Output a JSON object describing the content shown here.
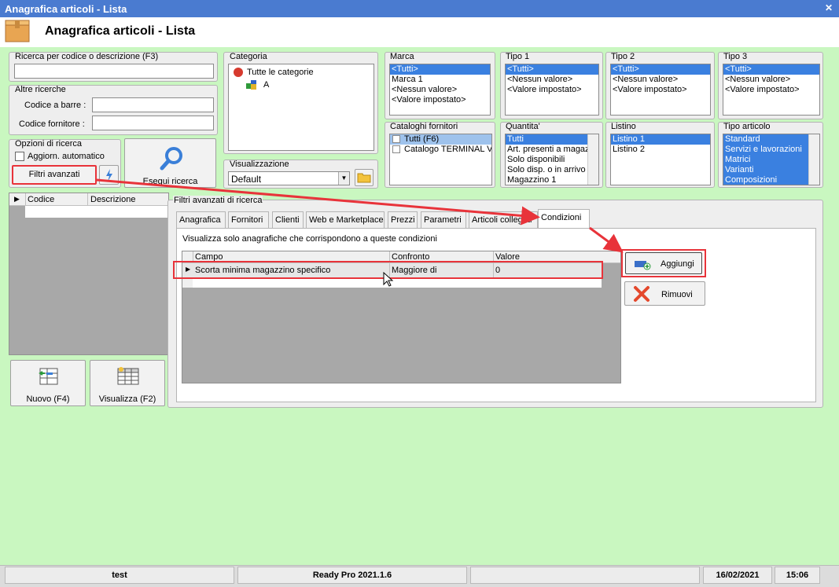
{
  "window": {
    "title": "Anagrafica articoli  - Lista",
    "header_title": "Anagrafica articoli  - Lista"
  },
  "search": {
    "code_desc_label": "Ricerca per codice o descrizione (F3)",
    "other_label": "Altre ricerche",
    "barcode_label": "Codice a barre :",
    "supplier_code_label": "Codice fornitore :",
    "options_label": "Opzioni di ricerca",
    "auto_update_label": "Aggiorn. automatico",
    "advanced_filters_button": "Filtri avanzati",
    "execute_button": "Esegui ricerca"
  },
  "categoria": {
    "label": "Categoria",
    "items": [
      "Tutte le categorie",
      "A"
    ]
  },
  "visualizzazione": {
    "label": "Visualizzazione",
    "value": "Default"
  },
  "marca": {
    "label": "Marca",
    "items": [
      "<Tutti>",
      "Marca 1",
      "<Nessun valore>",
      "<Valore impostato>"
    ]
  },
  "tipo1": {
    "label": "Tipo 1",
    "items": [
      "<Tutti>",
      "<Nessun valore>",
      "<Valore impostato>"
    ]
  },
  "tipo2": {
    "label": "Tipo 2",
    "items": [
      "<Tutti>",
      "<Nessun valore>",
      "<Valore impostato>"
    ]
  },
  "tipo3": {
    "label": "Tipo 3",
    "items": [
      "<Tutti>",
      "<Nessun valore>",
      "<Valore impostato>"
    ]
  },
  "cataloghi": {
    "label": "Cataloghi fornitori",
    "items": [
      "Tutti (F6)",
      "Catalogo TERMINAL VID"
    ]
  },
  "quantita": {
    "label": "Quantita'",
    "items": [
      "Tutti",
      "Art. presenti a magaz",
      "Solo disponibili",
      "Solo disp. o in arrivo",
      "Magazzino 1"
    ]
  },
  "listino": {
    "label": "Listino",
    "items": [
      "Listino 1",
      "Listino 2"
    ]
  },
  "tipo_articolo": {
    "label": "Tipo articolo",
    "items": [
      "Standard",
      "Servizi e lavorazioni",
      "Matrici",
      "Varianti",
      "Composizioni"
    ]
  },
  "articles_grid": {
    "col_code": "Codice",
    "col_desc": "Descrizione"
  },
  "actions": {
    "new_button": "Nuovo (F4)",
    "view_button": "Visualizza (F2)"
  },
  "advanced": {
    "title": "Filtri avanzati di ricerca",
    "tabs": [
      "Anagrafica",
      "Fornitori",
      "Clienti",
      "Web e Marketplace",
      "Prezzi",
      "Parametri",
      "Articoli collegati",
      "Condizioni"
    ],
    "hint": "Visualizza solo anagrafiche che corrispondono a queste condizioni",
    "col_campo": "Campo",
    "col_confronto": "Confronto",
    "col_valore": "Valore",
    "row": {
      "campo": "Scorta minima magazzino specifico",
      "confronto": "Maggiore di",
      "valore": "0"
    },
    "add_button": "Aggiungi",
    "remove_button": "Rimuovi"
  },
  "status": {
    "user": "test",
    "app": "Ready Pro 2021.1.6",
    "date": "16/02/2021",
    "time": "15:06"
  }
}
